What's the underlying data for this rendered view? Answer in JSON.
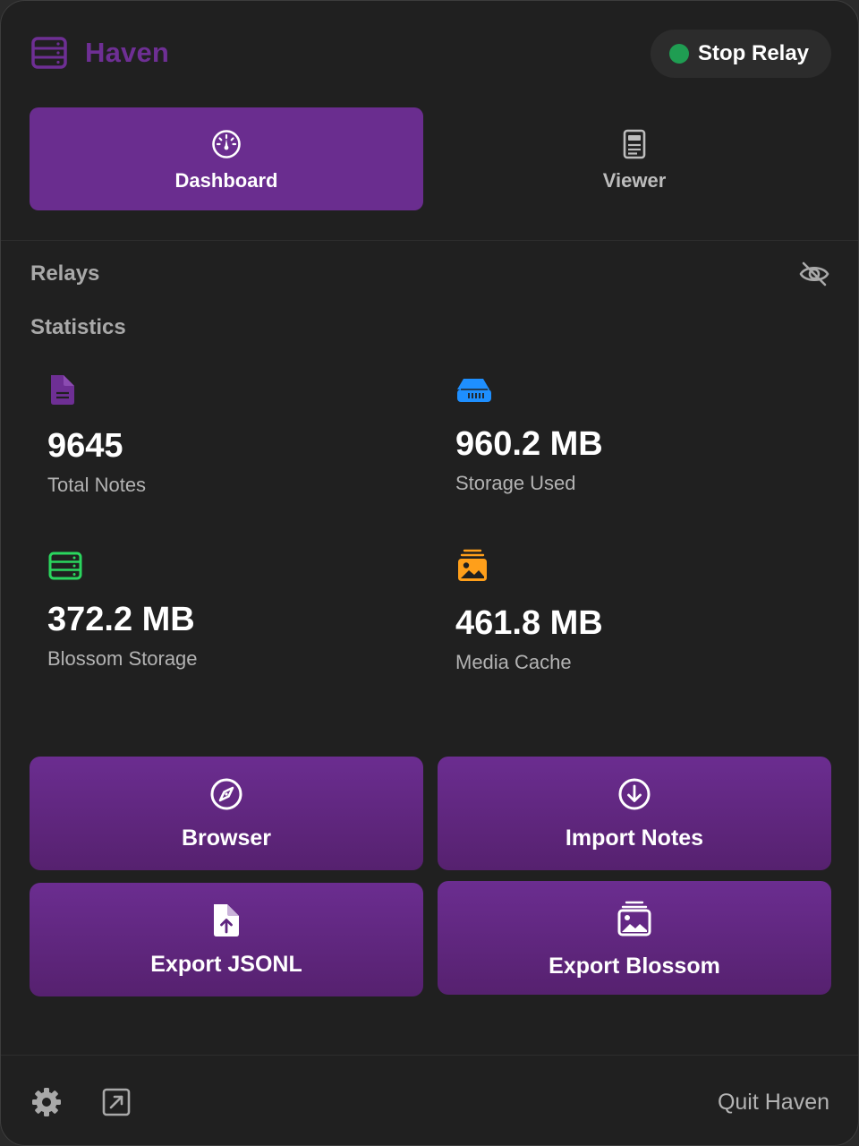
{
  "app": {
    "title": "Haven",
    "brand_color": "#6e2f94"
  },
  "header": {
    "relay_button_label": "Stop Relay",
    "relay_status_color": "#1f9d52"
  },
  "tabs": [
    {
      "label": "Dashboard",
      "icon": "gauge-icon",
      "active": true
    },
    {
      "label": "Viewer",
      "icon": "document-viewer-icon",
      "active": false
    }
  ],
  "sections": {
    "relays": "Relays",
    "statistics": "Statistics"
  },
  "stats": [
    {
      "value": "9645",
      "label": "Total Notes",
      "icon": "document-icon",
      "icon_color": "#6e2f94"
    },
    {
      "value": "960.2 MB",
      "label": "Storage Used",
      "icon": "drive-icon",
      "icon_color": "#1e8fff"
    },
    {
      "value": "372.2 MB",
      "label": "Blossom Storage",
      "icon": "server-icon",
      "icon_color": "#2ad65e"
    },
    {
      "value": "461.8 MB",
      "label": "Media Cache",
      "icon": "photo-stack-icon",
      "icon_color": "#ff9f1a"
    }
  ],
  "actions": [
    {
      "label": "Browser",
      "icon": "compass-icon"
    },
    {
      "label": "Import Notes",
      "icon": "download-circle-icon"
    },
    {
      "label": "Export JSONL",
      "icon": "file-upload-icon"
    },
    {
      "label": "Export Blossom",
      "icon": "photo-stack-icon"
    }
  ],
  "footer": {
    "quit_label": "Quit Haven"
  }
}
